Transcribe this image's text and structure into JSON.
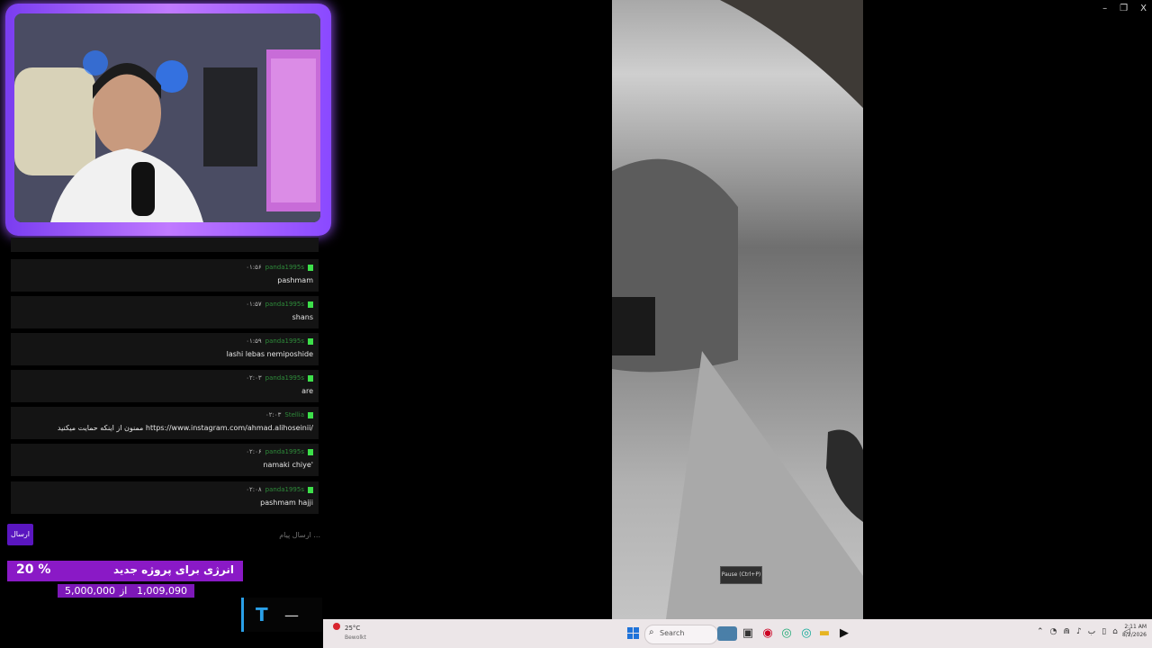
{
  "window_controls": {
    "minimize": "–",
    "maximize": "❐",
    "close": "X"
  },
  "chat": {
    "messages": [
      {
        "time": "۰۱:۵۶",
        "user": "panda1995s",
        "text": "pashmam"
      },
      {
        "time": "۰۱:۵۷",
        "user": "panda1995s",
        "text": "shans"
      },
      {
        "time": "۰۱:۵۹",
        "user": "panda1995s",
        "text": "lashi lebas nemiposhide"
      },
      {
        "time": "۰۲:۰۳",
        "user": "panda1995s",
        "text": "are"
      },
      {
        "time": "۰۲:۰۳",
        "user": "Stellia",
        "text": "ممنون از اینکه حمایت میکنید https://www.instagram.com/ahmad.alihoseinii/"
      },
      {
        "time": "۰۲:۰۶",
        "user": "panda1995s",
        "text": "namaki chiye'"
      },
      {
        "time": "۰۲:۰۸",
        "user": "panda1995s",
        "text": "pashmam hajji"
      }
    ],
    "send_button": "ارسال",
    "input_placeholder": "ارسال پیام ..."
  },
  "energy": {
    "title": "انرژی برای پروژه جدید",
    "percent_label": "20 %",
    "progress_percent": 20,
    "current": "1,009,090",
    "from_label": "از",
    "goal": "5,000,000"
  },
  "brand_dash": "—",
  "video": {
    "pause_tooltip": "Pause (Ctrl+P)"
  },
  "taskbar": {
    "weather_temp": "25°C",
    "weather_desc": "Bewolkt",
    "search_placeholder": "Search",
    "time": "2:11 AM",
    "date": "8/2/2026"
  }
}
